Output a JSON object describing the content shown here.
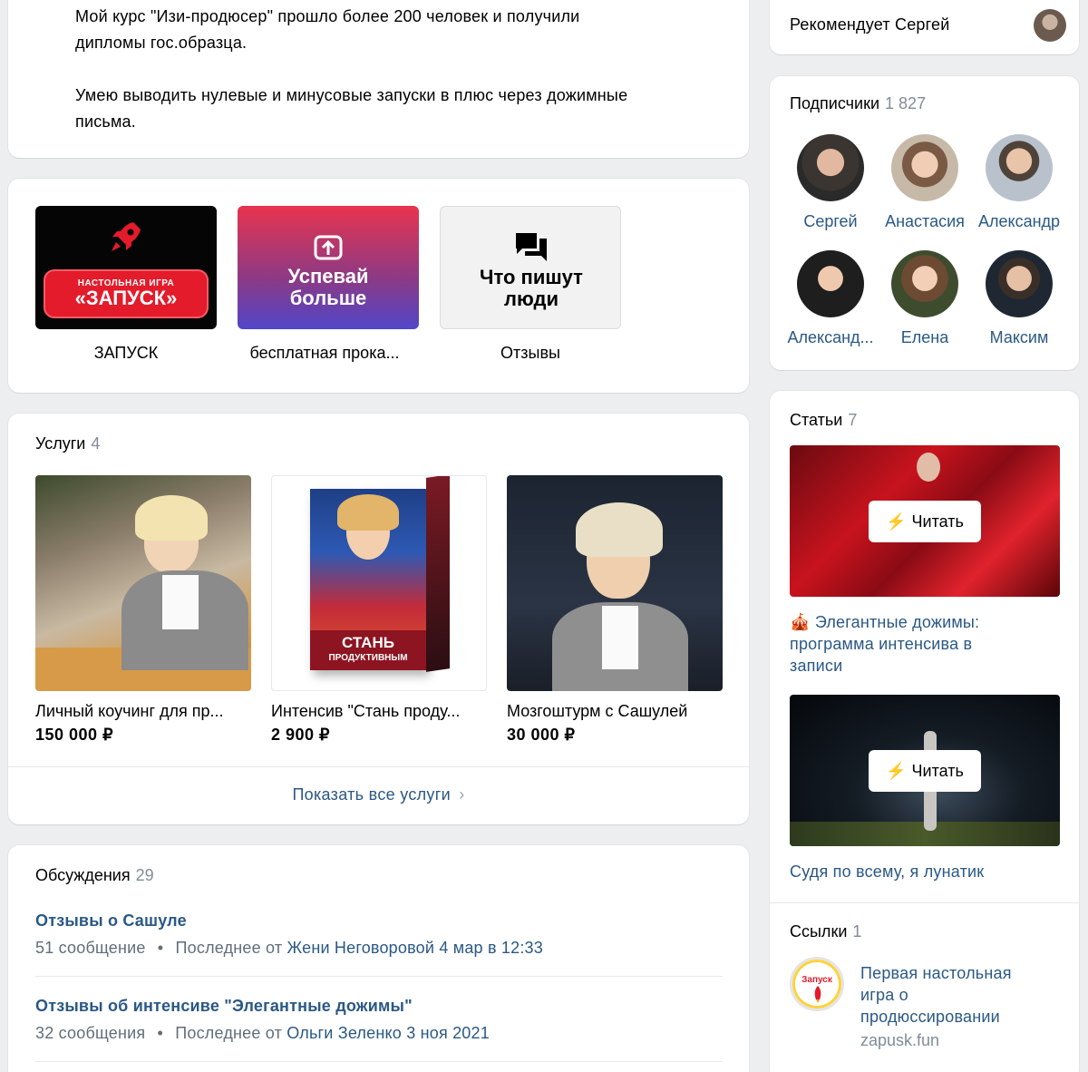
{
  "about": {
    "line1": "Мой курс \"Изи-продюсер\" прошло более 200 человек и получили",
    "line2": "дипломы гос.образца.",
    "line3": "Умею выводить нулевые и минусовые запуски в плюс через дожимные",
    "line4": "письма."
  },
  "apps": [
    {
      "tile_small": "НАСТОЛЬНАЯ ИГРА",
      "tile_big": "«ЗАПУСК»",
      "label": "ЗАПУСК",
      "icon": "rocket-icon"
    },
    {
      "tile_text1": "Успевай",
      "tile_text2": "больше",
      "label": "бесплатная прока...",
      "icon": "upload-box-icon"
    },
    {
      "tile_text1": "Что пишут",
      "tile_text2": "люди",
      "label": "Отзывы",
      "icon": "chat-bubbles-icon"
    }
  ],
  "services": {
    "title": "Услуги",
    "count": "4",
    "items": [
      {
        "name": "Личный коучинг для пр...",
        "price": "150 000 ₽"
      },
      {
        "name": "Интенсив \"Стань проду...",
        "price": "2 900 ₽",
        "box_text1": "СТАНЬ",
        "box_text2": "ПРОДУКТИВНЫМ"
      },
      {
        "name": "Мозгоштурм с Сашулей",
        "price": "30 000 ₽"
      }
    ],
    "show_all": "Показать все услуги"
  },
  "discussions": {
    "title": "Обсуждения",
    "count": "29",
    "topics": [
      {
        "title": "Отзывы о Сашуле",
        "count_text": "51 сообщение",
        "last_prefix": "Последнее от",
        "author": "Жени Неговоровой",
        "date": "4 мар в 12:33"
      },
      {
        "title": "Отзывы об интенсиве \"Элегантные дожимы\"",
        "count_text": "32 сообщения",
        "last_prefix": "Последнее от",
        "author": "Ольги Зеленко",
        "date": "3 ноя 2021"
      }
    ]
  },
  "recommend": {
    "text": "Рекомендует Сергей"
  },
  "subscribers": {
    "title": "Подписчики",
    "count": "1 827",
    "people": [
      {
        "name": "Сергей"
      },
      {
        "name": "Анастасия"
      },
      {
        "name": "Александр"
      },
      {
        "name": "Александ..."
      },
      {
        "name": "Елена"
      },
      {
        "name": "Максим"
      }
    ]
  },
  "articles": {
    "title": "Статьи",
    "count": "7",
    "read_label": "Читать",
    "items": [
      {
        "title_line1": "🎪 Элегантные дожимы:",
        "title_line2": "программа интенсива в",
        "title_line3": "записи"
      },
      {
        "title_line1": "Судя по всему, я лунатик"
      }
    ]
  },
  "links": {
    "title": "Ссылки",
    "count": "1",
    "logo_text": "Запуск",
    "item_line1": "Первая настольная",
    "item_line2": "игра о",
    "item_line3": "продюссировании",
    "domain": "zapusk.fun"
  },
  "colors": {
    "accent": "#2a5885",
    "page_bg": "#edeef0",
    "red": "#e31b2b"
  }
}
